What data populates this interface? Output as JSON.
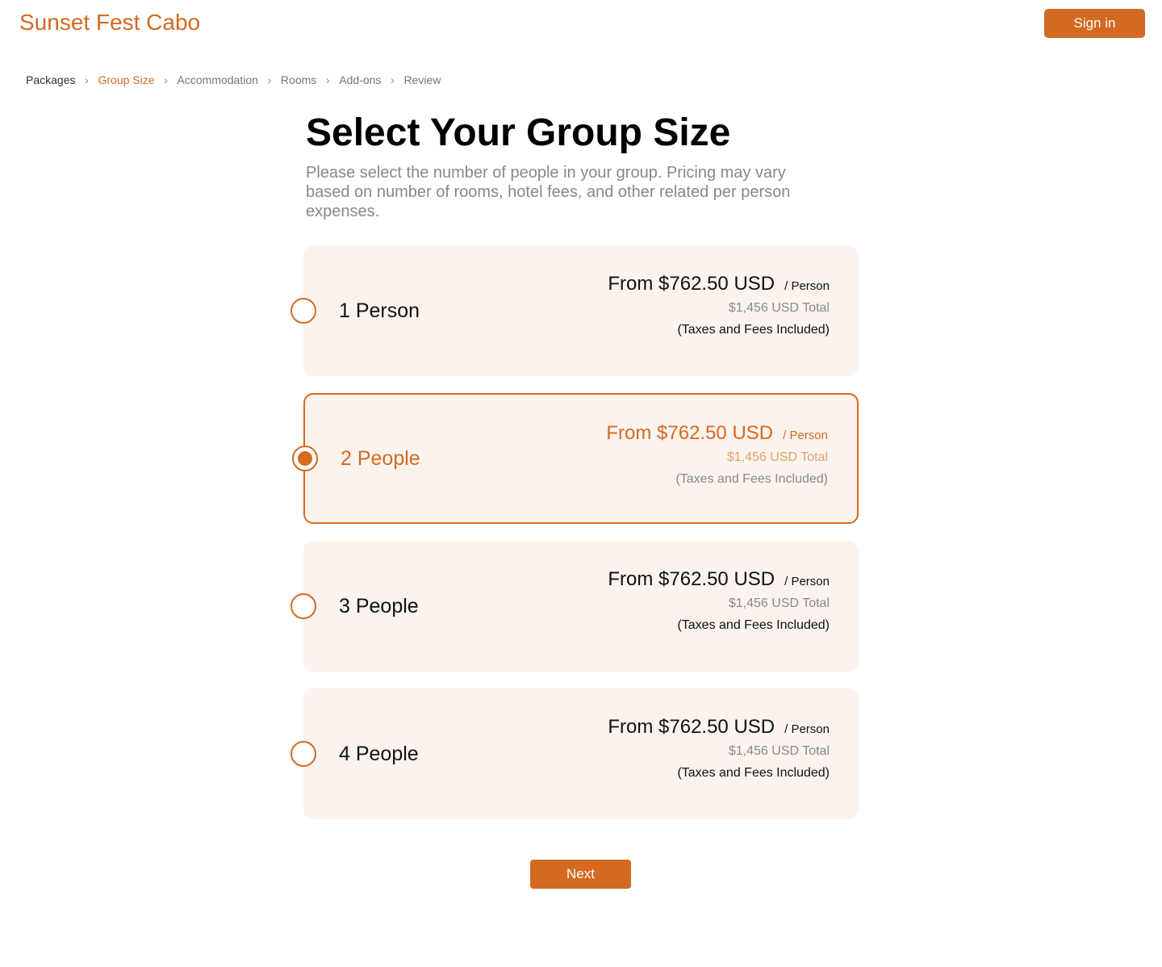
{
  "header": {
    "brand": "Sunset Fest Cabo",
    "signin_label": "Sign in"
  },
  "breadcrumb": {
    "separator": "›",
    "steps": [
      {
        "label": "Packages",
        "state": "done"
      },
      {
        "label": "Group Size",
        "state": "current"
      },
      {
        "label": "Accommodation",
        "state": "upcoming"
      },
      {
        "label": "Rooms",
        "state": "upcoming"
      },
      {
        "label": "Add-ons",
        "state": "upcoming"
      },
      {
        "label": "Review",
        "state": "upcoming"
      }
    ]
  },
  "main": {
    "title": "Select Your Group Size",
    "intro": "Please select the number of people in your group. Pricing may vary based on number of rooms, hotel fees, and other related per person expenses."
  },
  "options": [
    {
      "label": "1 Person",
      "price": "From $762.50 USD",
      "per": "/ Person",
      "total": "$1,456 USD Total",
      "taxes": "(Taxes and Fees Included)",
      "selected": false
    },
    {
      "label": "2 People",
      "price": "From $762.50 USD",
      "per": "/ Person",
      "total": "$1,456 USD Total",
      "taxes": "(Taxes and Fees Included)",
      "selected": true
    },
    {
      "label": "3 People",
      "price": "From $762.50 USD",
      "per": "/ Person",
      "total": "$1,456 USD Total",
      "taxes": "(Taxes and Fees Included)",
      "selected": false
    },
    {
      "label": "4 People",
      "price": "From $762.50 USD",
      "per": "/ Person",
      "total": "$1,456 USD Total",
      "taxes": "(Taxes and Fees Included)",
      "selected": false
    }
  ],
  "footer": {
    "next_label": "Next"
  },
  "colors": {
    "accent": "#d46a22",
    "card_background": "#fbf3ee"
  }
}
